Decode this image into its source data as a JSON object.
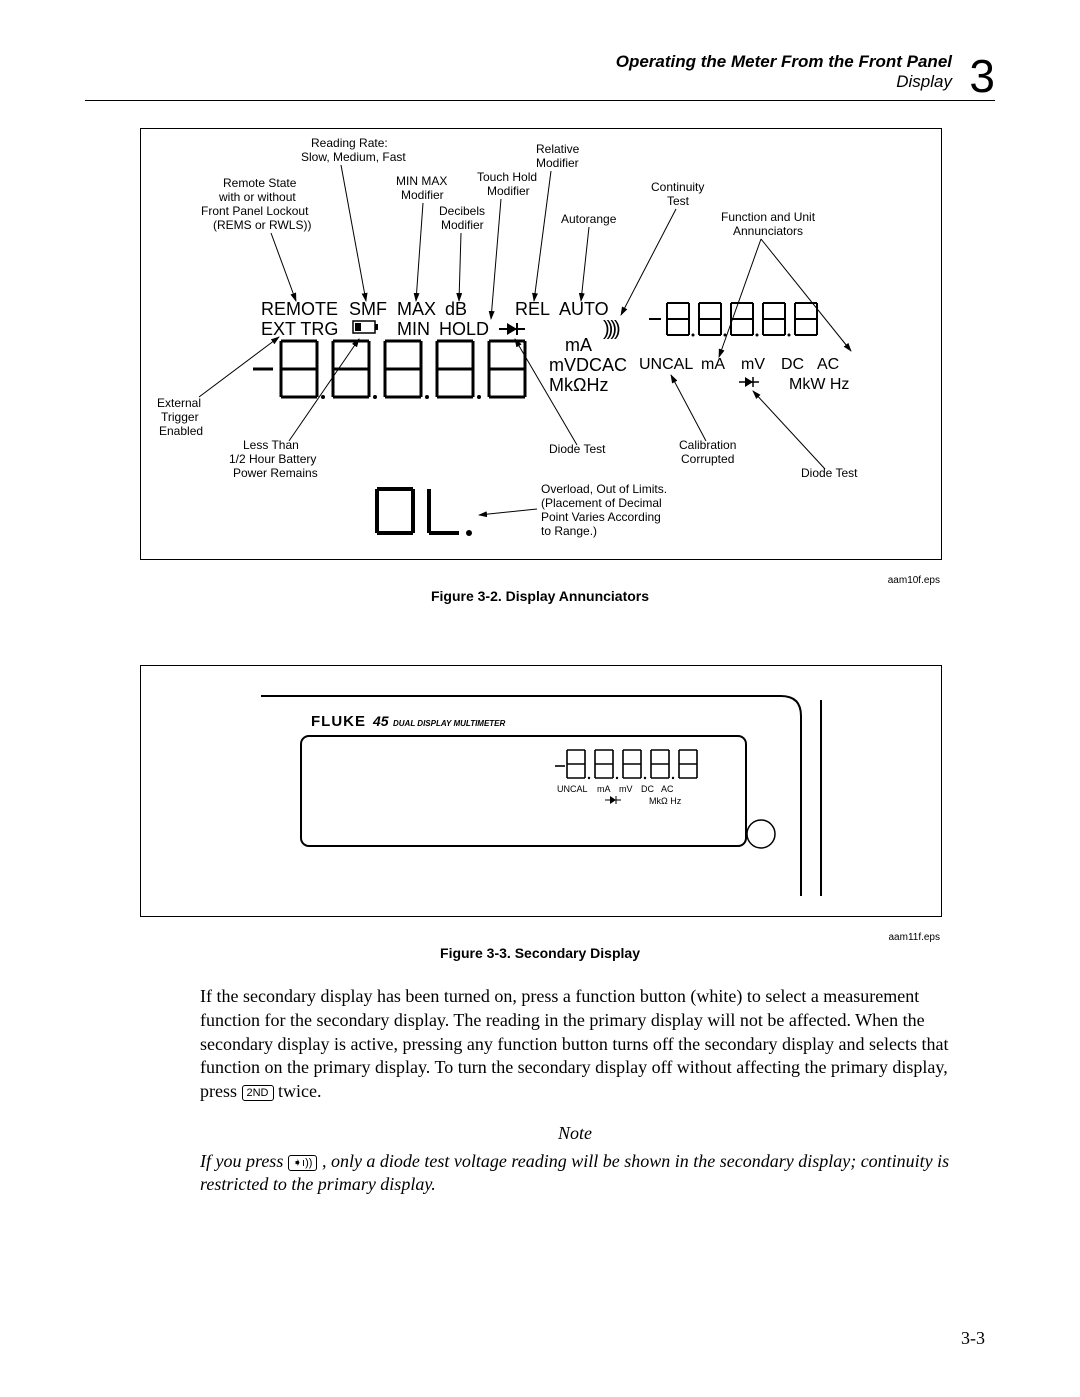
{
  "header": {
    "title": "Operating the Meter From the Front Panel",
    "subtitle": "Display",
    "chapter_num": "3"
  },
  "fig1": {
    "caption": "Figure 3-2. Display Annunciators",
    "eps": "aam10f.eps",
    "labels": {
      "reading_rate": "Reading Rate:\nSlow, Medium, Fast",
      "relative_mod": "Relative\nModifier",
      "remote_state": "Remote State\nwith or without\nFront Panel Lockout\n(REMS or RWLS))",
      "minmax": "MIN MAX\nModifier",
      "touch_hold": "Touch Hold\nModifier",
      "decibels": "Decibels\nModifier",
      "autorange": "Autorange",
      "continuity": "Continuity\nTest",
      "func_unit": "Function and Unit\nAnnunciators",
      "remote": "REMOTE",
      "smf": "SMF",
      "max": "MAX",
      "db": "dB",
      "rel": "REL",
      "auto": "AUTO",
      "ext_trg": "EXT TRG",
      "min": "MIN",
      "hold": "HOLD",
      "ma": "mA",
      "mvdcac": "mVDCAC",
      "mkohz": "MkΩHz",
      "uncal": "UNCAL",
      "ma2": "mA",
      "mv": "mV",
      "dc": "DC",
      "ac": "AC",
      "mkw_hz": "MkW Hz",
      "external_trigger": "External\nTrigger\nEnabled",
      "low_batt": "Less Than\n1/2 Hour Battery\nPower Remains",
      "diode_test": "Diode Test",
      "calibration": "Calibration\nCorrupted",
      "diode_test2": "Diode Test",
      "overload": "Overload, Out of Limits.\n(Placement of Decimal\nPoint Varies According\nto Range.)",
      "ol": "OL."
    }
  },
  "fig2": {
    "caption": "Figure 3-3. Secondary Display",
    "eps": "aam11f.eps",
    "brand": "FLUKE",
    "model": "45",
    "subtitle": "DUAL DISPLAY MULTIMETER",
    "uncal": "UNCAL",
    "ma": "mA",
    "mv": "mV",
    "dc": "DC",
    "ac": "AC",
    "mkohz": "MkΩ Hz"
  },
  "body": {
    "para": "If the secondary display has been turned on, press a function button (white) to select a measurement function for the secondary display. The reading in the primary display will not be affected. When the secondary display is active, pressing any function button turns off the secondary display and selects that function on the primary display. To turn the secondary display off without affecting the primary display, press ",
    "para_tail": " twice.",
    "key_2nd": "2ND",
    "note_head": "Note",
    "note_body_a": "If you press ",
    "note_body_b": ", only a diode test voltage reading will be shown in the secondary display; continuity is restricted to the primary display.",
    "key_diode": "➧ı))"
  },
  "page_number": "3-3"
}
